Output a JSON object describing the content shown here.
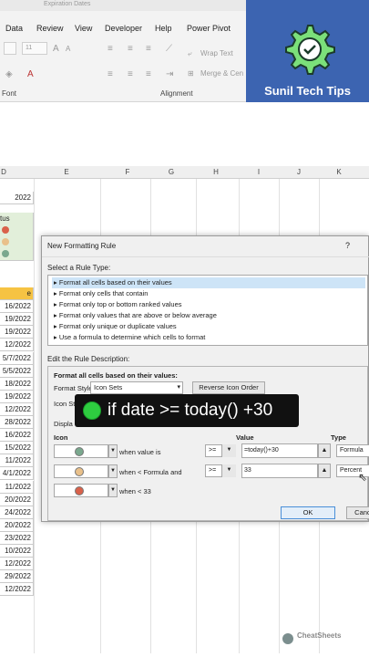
{
  "window": {
    "title": "Expiration Dates"
  },
  "menu": {
    "items": [
      "Data",
      "Review",
      "View",
      "Developer",
      "Help",
      "Power Pivot"
    ]
  },
  "ribbon": {
    "font_size_value": "11",
    "wrap_text_label": "Wrap Text",
    "merge_label": "Merge & Cen",
    "group_font": "Font",
    "group_alignment": "Alignment"
  },
  "brand": {
    "name": "Sunil Tech Tips",
    "accent": "#3c64b1"
  },
  "sheet": {
    "columns": [
      "E",
      "F",
      "G",
      "H",
      "I",
      "J",
      "K"
    ],
    "row_header_letter": "D",
    "column_a_values": [
      "2022",
      "tus",
      "",
      "",
      "",
      "e",
      "16/2022",
      "19/2022",
      "19/2022",
      "12/2022",
      "5/7/2022",
      "5/5/2022",
      "18/2022",
      "19/2022",
      "12/2022",
      "28/2022",
      "16/2022",
      "15/2022",
      "11/2022",
      "4/1/2022",
      "11/2022",
      "20/2022",
      "24/2022",
      "20/2022",
      "23/2022",
      "10/2022",
      "12/2022",
      "29/2022",
      "12/2022"
    ]
  },
  "dialog": {
    "title": "New Formatting Rule",
    "help": "?",
    "select_rule_type_label": "Select a Rule Type:",
    "rule_types": [
      "Format all cells based on their values",
      "Format only cells that contain",
      "Format only top or bottom ranked values",
      "Format only values that are above or below average",
      "Format only unique or duplicate values",
      "Use a formula to determine which cells to format"
    ],
    "edit_description_label": "Edit the Rule Description:",
    "format_all_label": "Format all cells based on their values:",
    "format_style_label": "Format Style:",
    "format_style_value": "Icon Sets",
    "reverse_icon_order": "Reverse Icon Order",
    "icon_style_label": "Icon St",
    "display_label": "Displa",
    "col_icon": "Icon",
    "col_value": "Value",
    "col_type": "Type",
    "rules": [
      {
        "color": "#7aa88e",
        "condition": "when value is",
        "operator": ">=",
        "value": "=today()+30",
        "type": "Formula"
      },
      {
        "color": "#e9c08a",
        "condition": "when < Formula and",
        "operator": ">=",
        "value": "33",
        "type": "Percent"
      },
      {
        "color": "#d9614a",
        "condition": "when < 33",
        "operator": "",
        "value": "",
        "type": ""
      }
    ],
    "ok_label": "OK",
    "cancel_label": "Cance"
  },
  "overlay": {
    "text": "if date >= today() +30"
  },
  "watermark": {
    "text": "CheatSheets"
  }
}
